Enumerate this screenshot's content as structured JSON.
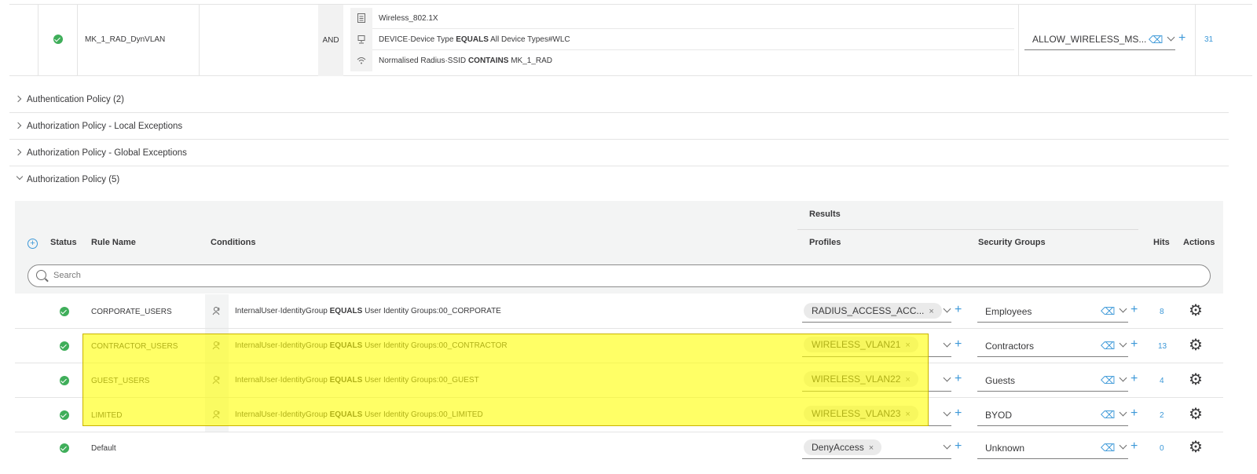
{
  "top_rule": {
    "name": "MK_1_RAD_DynVLAN",
    "operator": "AND",
    "conditions": [
      {
        "icon": "document-icon",
        "attribute": "Wireless_802.1X",
        "op": "",
        "value": ""
      },
      {
        "icon": "device-icon",
        "attribute": "DEVICE·Device Type",
        "op": "EQUALS",
        "value": "All Device Types#WLC"
      },
      {
        "icon": "wifi-icon",
        "attribute": "Normalised Radius·SSID",
        "op": "CONTAINS",
        "value": "MK_1_RAD"
      }
    ],
    "result": "ALLOW_WIRELESS_MS...",
    "hits": "31"
  },
  "sections": [
    {
      "title": "Authentication Policy (2)",
      "expanded": false
    },
    {
      "title": "Authorization Policy - Local Exceptions",
      "expanded": false
    },
    {
      "title": "Authorization Policy - Global Exceptions",
      "expanded": false
    },
    {
      "title": "Authorization Policy (5)",
      "expanded": true
    }
  ],
  "table": {
    "headers": {
      "results": "Results",
      "status": "Status",
      "rule_name": "Rule Name",
      "conditions": "Conditions",
      "profiles": "Profiles",
      "security_groups": "Security Groups",
      "hits": "Hits",
      "actions": "Actions"
    },
    "search_placeholder": "Search",
    "rows": [
      {
        "name": "CORPORATE_USERS",
        "attr": "InternalUser·IdentityGroup",
        "op": "EQUALS",
        "value": "User Identity Groups:00_CORPORATE",
        "profile": "RADIUS_ACCESS_ACC...",
        "sg": "Employees",
        "hits": "8"
      },
      {
        "name": "CONTRACTOR_USERS",
        "attr": "InternalUser·IdentityGroup",
        "op": "EQUALS",
        "value": "User Identity Groups:00_CONTRACTOR",
        "profile": "WIRELESS_VLAN21",
        "sg": "Contractors",
        "hits": "13"
      },
      {
        "name": "GUEST_USERS",
        "attr": "InternalUser·IdentityGroup",
        "op": "EQUALS",
        "value": "User Identity Groups:00_GUEST",
        "profile": "WIRELESS_VLAN22",
        "sg": "Guests",
        "hits": "4"
      },
      {
        "name": "LIMITED",
        "attr": "InternalUser·IdentityGroup",
        "op": "EQUALS",
        "value": "User Identity Groups:00_LIMITED",
        "profile": "WIRELESS_VLAN23",
        "sg": "BYOD",
        "hits": "2"
      },
      {
        "name": "Default",
        "attr": "",
        "op": "",
        "value": "",
        "profile": "DenyAccess",
        "sg": "Unknown",
        "hits": "0"
      }
    ]
  },
  "colors": {
    "accent": "#3c98d8",
    "status_ok": "#3fae5a",
    "highlight": "#ffff00"
  }
}
